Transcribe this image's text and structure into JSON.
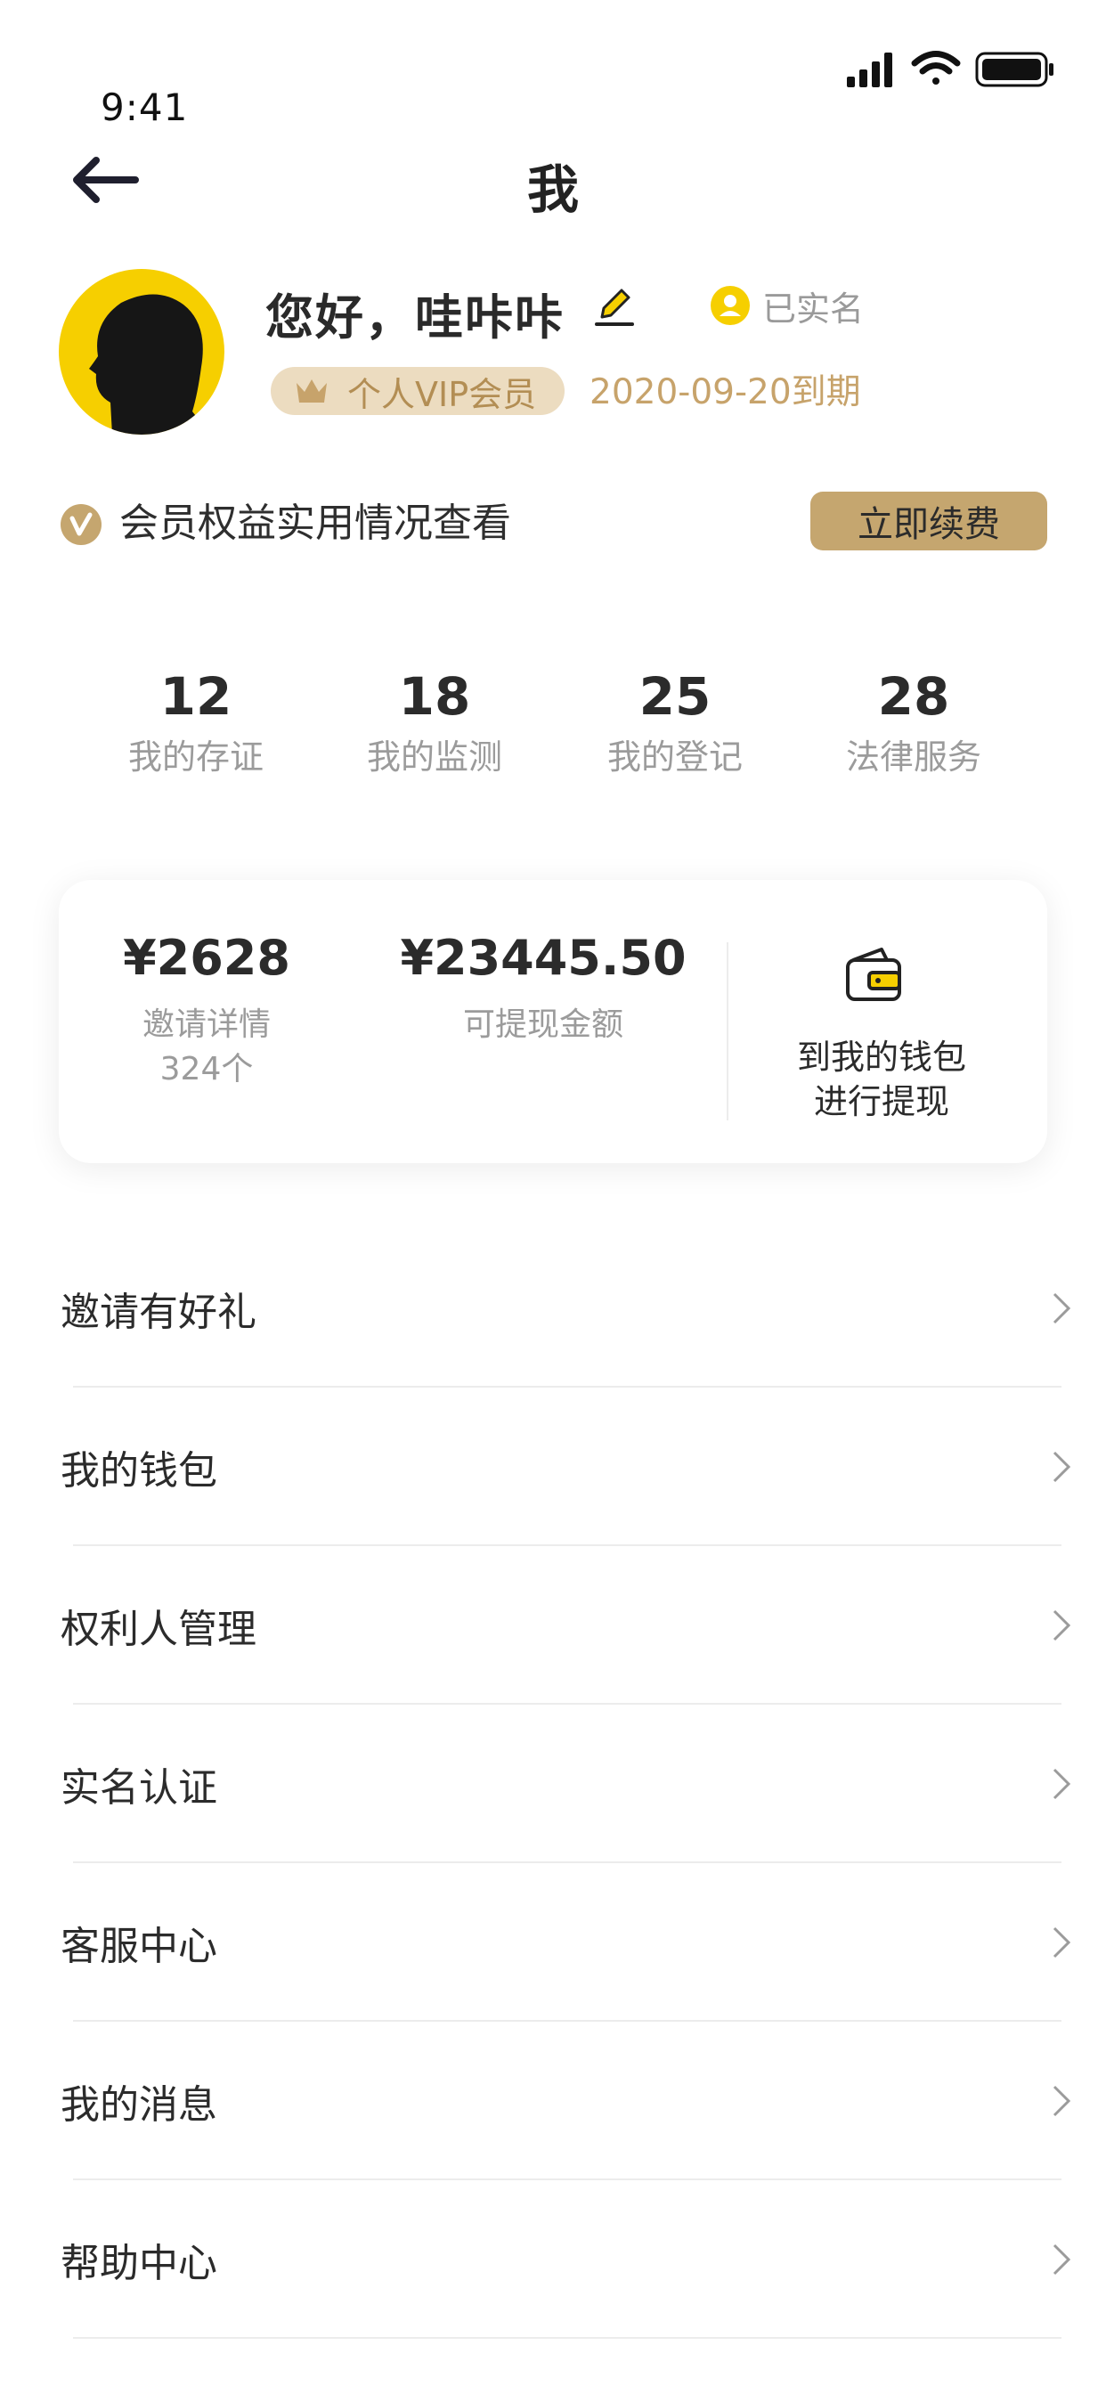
{
  "status_bar": {
    "time": "9:41",
    "icons": [
      "signal-icon",
      "wifi-icon",
      "battery-icon"
    ]
  },
  "nav": {
    "title": "我",
    "back_icon": "arrow-left-icon"
  },
  "profile": {
    "greeting": "您好，哇咔咔",
    "verified_label": "已实名",
    "vip_label": "个人VIP会员",
    "expire_text": "2020-09-20到期"
  },
  "benefit": {
    "text": "会员权益实用情况查看",
    "renew_label": "立即续费"
  },
  "stats": [
    {
      "value": "12",
      "label": "我的存证"
    },
    {
      "value": "18",
      "label": "我的监测"
    },
    {
      "value": "25",
      "label": "我的登记"
    },
    {
      "value": "28",
      "label": "法律服务"
    }
  ],
  "wallet": {
    "invite_amount": "¥2628",
    "invite_label": "邀请详情",
    "invite_count": "324个",
    "withdrawable_amount": "¥23445.50",
    "withdrawable_label": "可提现金额",
    "wallet_line1": "到我的钱包",
    "wallet_line2": "进行提现"
  },
  "menu": [
    {
      "label": "邀请有好礼"
    },
    {
      "label": "我的钱包"
    },
    {
      "label": "权利人管理"
    },
    {
      "label": "实名认证"
    },
    {
      "label": "客服中心"
    },
    {
      "label": "我的消息"
    },
    {
      "label": "帮助中心"
    }
  ],
  "colors": {
    "brand_gold": "#c5a66f",
    "accent_yellow": "#f6cf00",
    "badge_bg": "#ecdcc0"
  }
}
